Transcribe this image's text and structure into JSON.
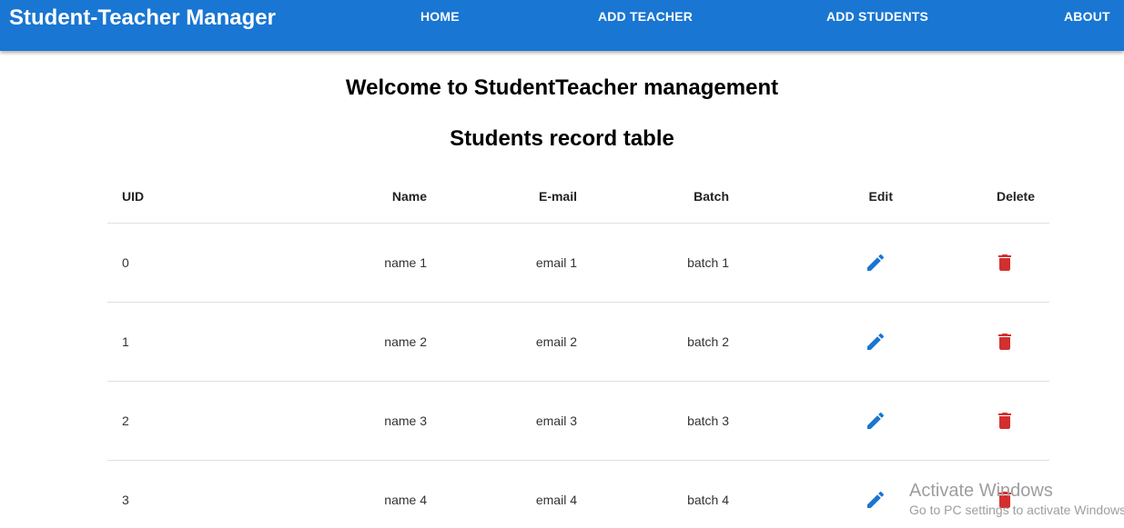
{
  "appbar": {
    "title": "Student-Teacher Manager",
    "nav": [
      {
        "label": "HOME"
      },
      {
        "label": "ADD TEACHER"
      },
      {
        "label": "ADD STUDENTS"
      },
      {
        "label": "ABOUT"
      }
    ],
    "color": "#1976d2"
  },
  "headings": {
    "welcome": "Welcome to StudentTeacher management",
    "table_title": "Students record table"
  },
  "table": {
    "columns": [
      "UID",
      "Name",
      "E-mail",
      "Batch",
      "Edit",
      "Delete"
    ],
    "rows": [
      {
        "uid": "0",
        "name": "name 1",
        "email": "email 1",
        "batch": "batch 1"
      },
      {
        "uid": "1",
        "name": "name 2",
        "email": "email 2",
        "batch": "batch 2"
      },
      {
        "uid": "2",
        "name": "name 3",
        "email": "email 3",
        "batch": "batch 3"
      },
      {
        "uid": "3",
        "name": "name 4",
        "email": "email 4",
        "batch": "batch 4"
      }
    ],
    "edit_icon": "pencil-icon",
    "delete_icon": "trash-icon",
    "edit_color": "#1976d2",
    "delete_color": "#d32f2f"
  },
  "watermark": {
    "title": "Activate Windows",
    "subtitle": "Go to PC settings to activate Windows."
  }
}
